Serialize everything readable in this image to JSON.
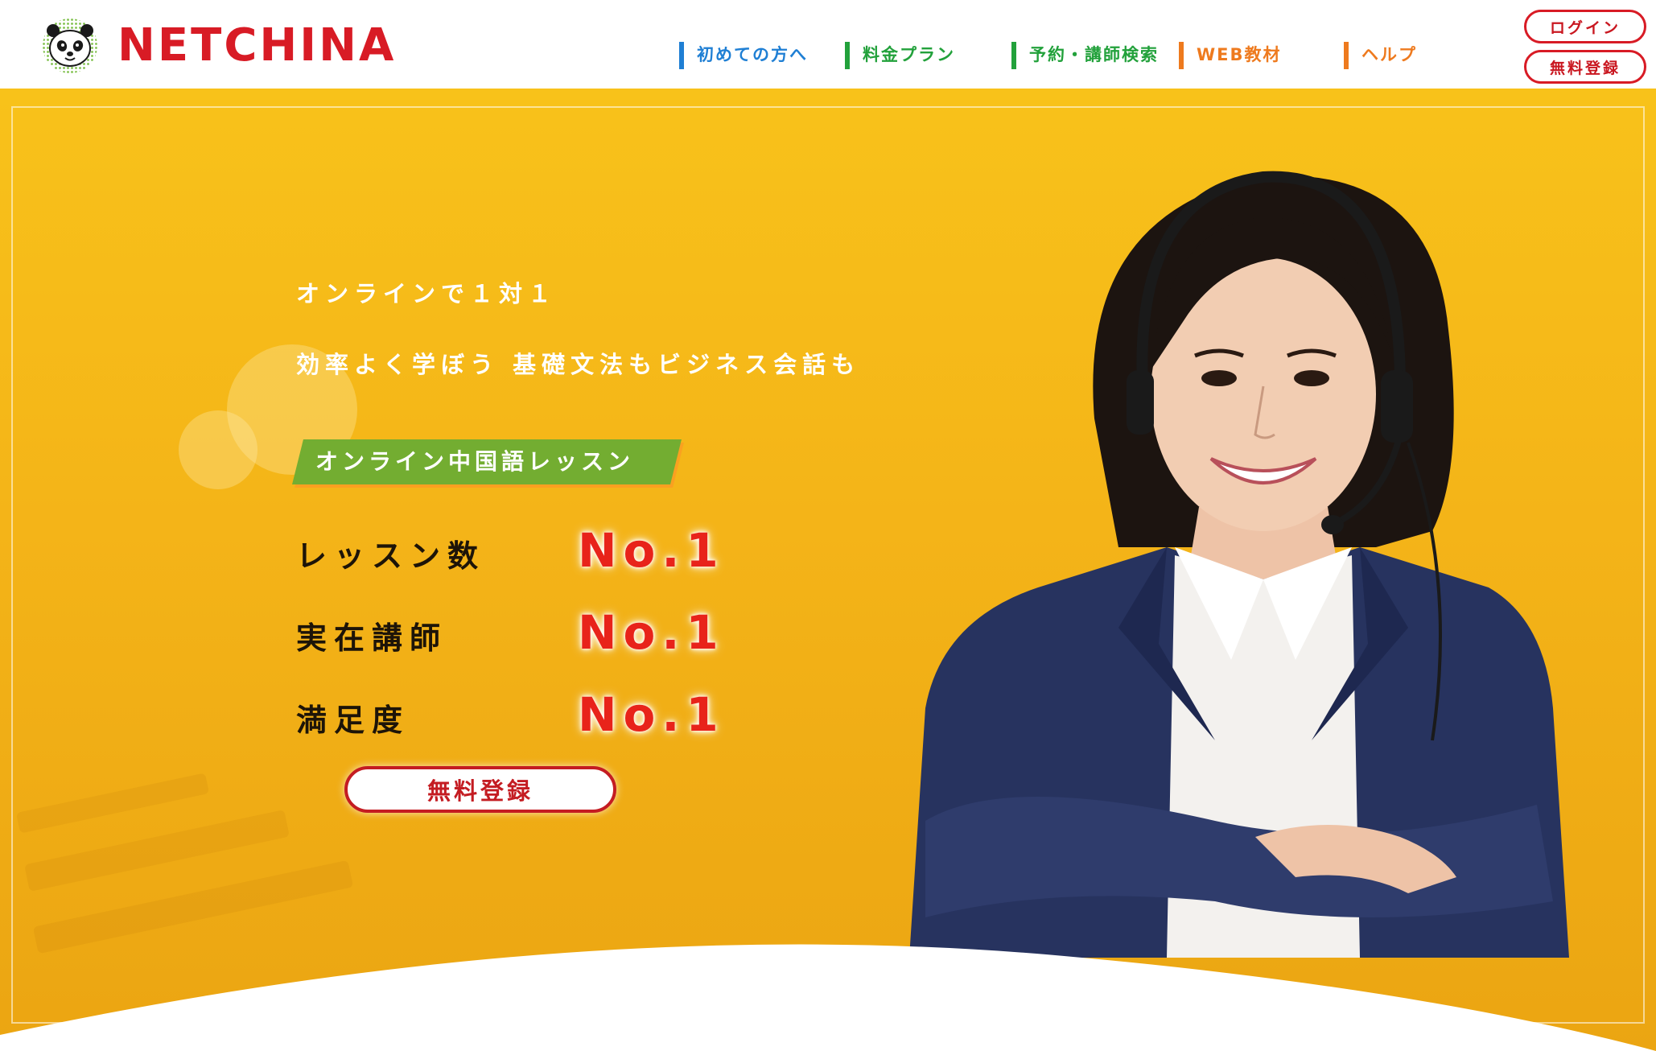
{
  "header": {
    "brand": "NETCHINA",
    "nav": [
      {
        "label": "初めての方へ",
        "color": "blue"
      },
      {
        "label": "料金プラン",
        "color": "green"
      },
      {
        "label": "予約・講師検索",
        "color": "green"
      },
      {
        "label": "WEB教材",
        "color": "orange"
      },
      {
        "label": "ヘルプ",
        "color": "orange"
      }
    ],
    "login_label": "ログイン",
    "signup_label": "無料登録"
  },
  "hero": {
    "subtitle_1": "オンラインで１対１",
    "subtitle_2": "効率よく学ぼう 基礎文法もビジネス会話も",
    "ribbon": "オンライン中国語レッスン",
    "stats": [
      {
        "label": "レッスン数",
        "value": "No.1"
      },
      {
        "label": "実在講師",
        "value": "No.1"
      },
      {
        "label": "満足度",
        "value": "No.1"
      }
    ],
    "cta_label": "無料登録"
  },
  "colors": {
    "brand_red": "#d81b25",
    "hero_yellow": "#f8c21a",
    "ribbon_green": "#73ad31",
    "nav_blue": "#1f7fd4",
    "nav_green": "#22a13b",
    "nav_orange": "#ee7a1e"
  },
  "icons": {
    "logo": "panda-logo-icon"
  }
}
